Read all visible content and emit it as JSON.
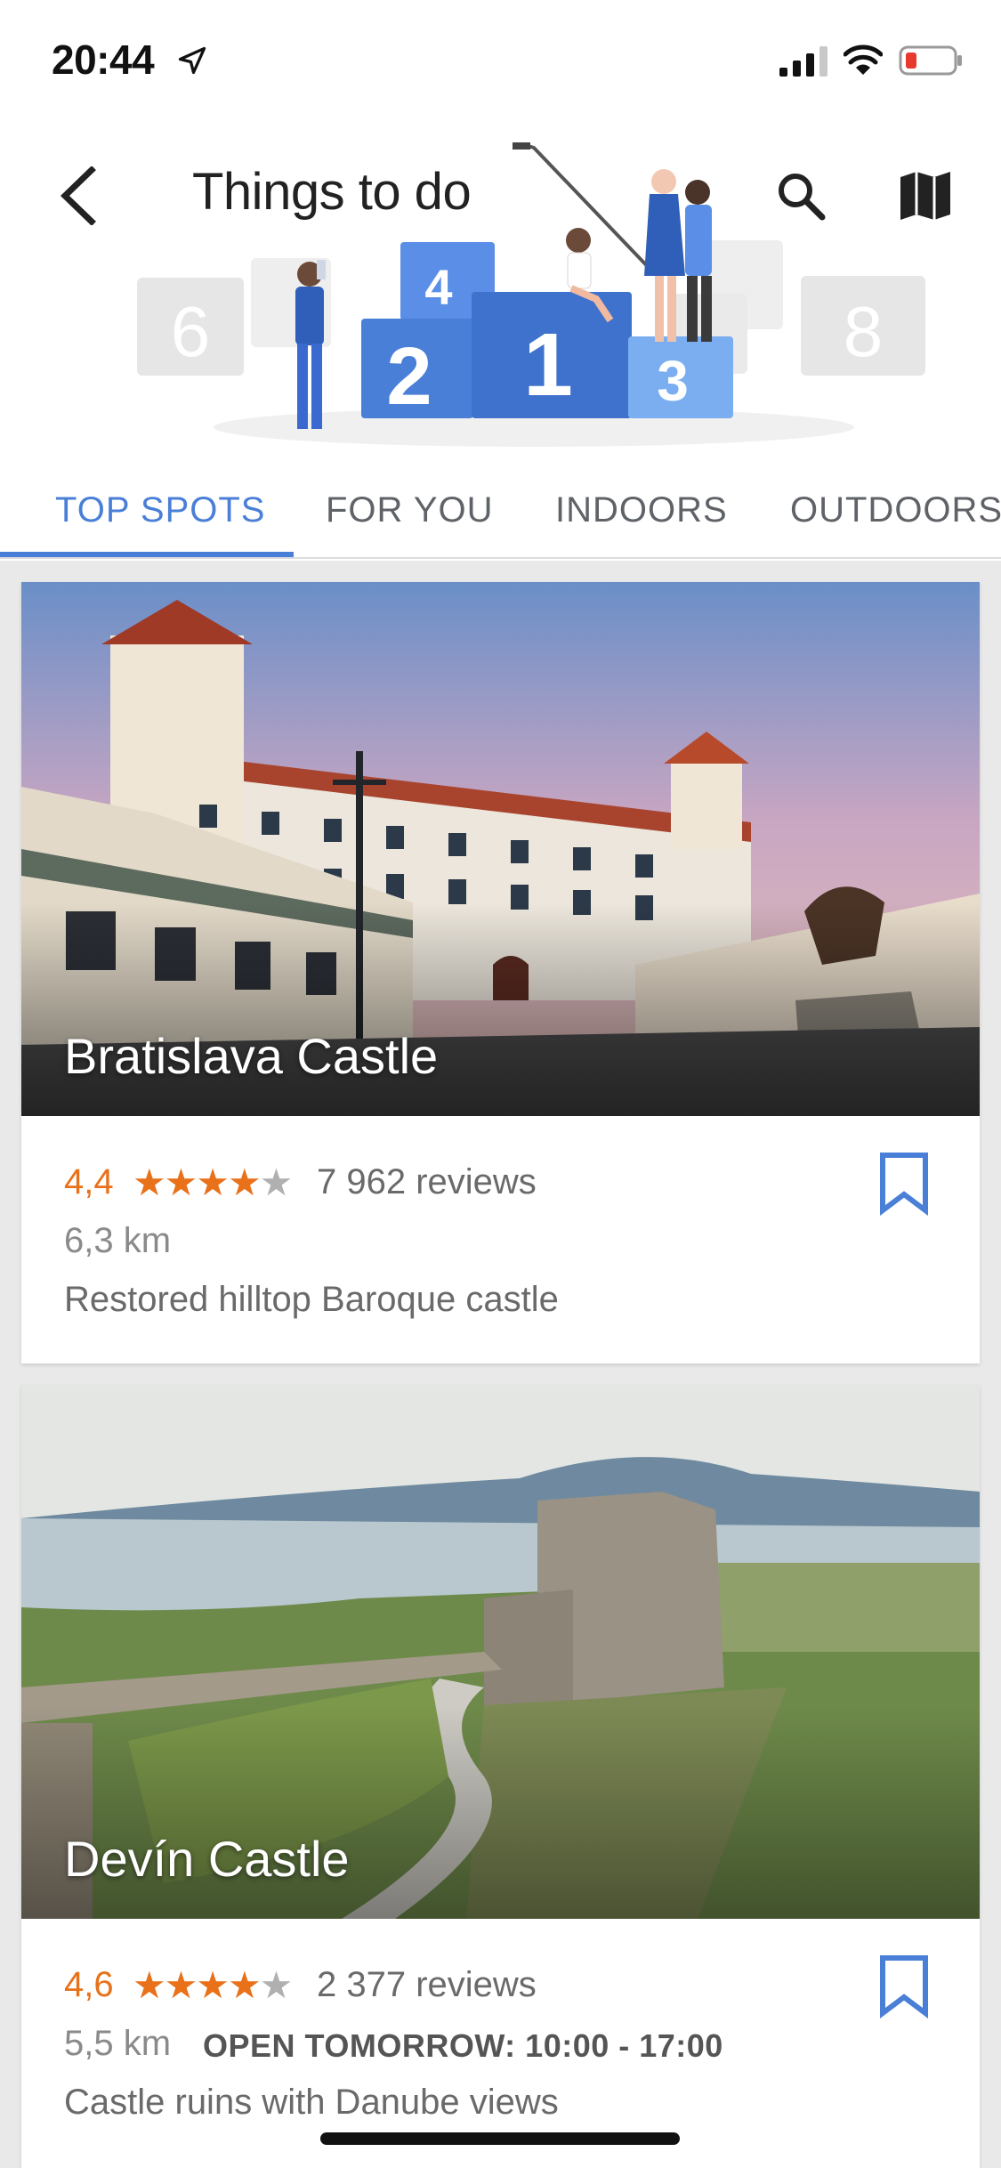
{
  "status_bar": {
    "time": "20:44"
  },
  "header": {
    "title": "Things to do",
    "podium_numbers": [
      "6",
      "4",
      "2",
      "1",
      "3",
      "8"
    ]
  },
  "tabs": [
    {
      "label": "TOP SPOTS",
      "active": true
    },
    {
      "label": "FOR YOU",
      "active": false
    },
    {
      "label": "INDOORS",
      "active": false
    },
    {
      "label": "OUTDOORS",
      "active": false
    }
  ],
  "places": [
    {
      "name": "Bratislava Castle",
      "rating": "4,4",
      "stars_value": 4.4,
      "reviews": "7 962 reviews",
      "distance": "6,3 km",
      "hours": "",
      "description": "Restored hilltop Baroque castle"
    },
    {
      "name": "Devín Castle",
      "rating": "4,6",
      "stars_value": 4.6,
      "reviews": "2 377 reviews",
      "distance": "5,5 km",
      "hours": "OPEN TOMORROW: 10:00 - 17:00",
      "description": "Castle ruins with Danube views"
    }
  ],
  "colors": {
    "accent": "#4a7fd7",
    "rating": "#e8711a",
    "background": "#e9e9e9"
  },
  "icons": [
    "location-arrow-icon",
    "signal-icon",
    "wifi-icon",
    "battery-icon",
    "back-arrow-icon",
    "search-icon",
    "map-icon",
    "star-icon",
    "bookmark-icon"
  ]
}
